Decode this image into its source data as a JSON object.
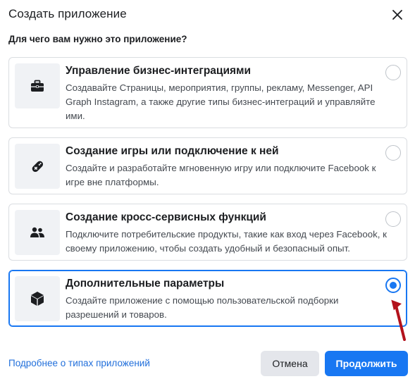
{
  "dialog": {
    "title": "Создать приложение",
    "close_icon": "close-icon",
    "question": "Для чего вам нужно это приложение?"
  },
  "options": [
    {
      "icon": "briefcase-icon",
      "title": "Управление бизнес-интеграциями",
      "description": "Создавайте Страницы, мероприятия, группы, рекламу, Messenger, API Graph Instagram, а также другие типы бизнес-интеграций и управляйте ими.",
      "selected": false
    },
    {
      "icon": "gamepad-icon",
      "title": "Создание игры или подключение к ней",
      "description": "Создайте и разработайте мгновенную игру или подключите Facebook к игре вне платформы.",
      "selected": false
    },
    {
      "icon": "people-icon",
      "title": "Создание кросс-сервисных функций",
      "description": "Подключите потребительские продукты, такие как вход через Facebook, к своему приложению, чтобы создать удобный и безопасный опыт.",
      "selected": false
    },
    {
      "icon": "cube-icon",
      "title": "Дополнительные параметры",
      "description": "Создайте приложение с помощью пользовательской подборки разрешений и товаров.",
      "selected": true
    }
  ],
  "footer": {
    "link_label": "Подробнее о типах приложений",
    "cancel_label": "Отмена",
    "continue_label": "Продолжить"
  },
  "colors": {
    "accent": "#1877f2",
    "annotation_arrow": "#b3121c"
  }
}
